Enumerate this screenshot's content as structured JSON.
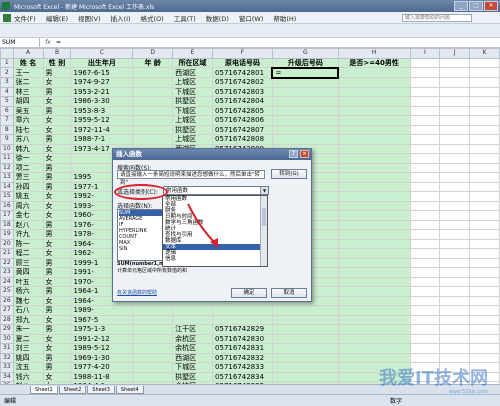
{
  "window": {
    "title": "Microsoft Excel - 新建 Microsoft Excel 工作表.xls"
  },
  "menu": [
    "文件(F)",
    "编辑(E)",
    "视图(V)",
    "插入(I)",
    "格式(O)",
    "工具(T)",
    "数据(D)",
    "窗口(W)",
    "帮助(H)"
  ],
  "help_placeholder": "键入需要帮助的问题",
  "formula": {
    "name_box": "SUM",
    "fx": "fx",
    "content": "="
  },
  "columns": [
    "A",
    "B",
    "C",
    "D",
    "E",
    "F",
    "G",
    "H",
    "I",
    "J",
    "K"
  ],
  "headers": [
    "姓 名",
    "性 别",
    "出生年月",
    "年 龄",
    "所在区域",
    "原电话号码",
    "升级后号码",
    "是否>=40男性"
  ],
  "rows": [
    [
      "王一",
      "男",
      "1967-6-15",
      "",
      "西湖区",
      "05716742801",
      "="
    ],
    [
      "张二",
      "女",
      "1974-9-27",
      "",
      "上城区",
      "05716742802",
      ""
    ],
    [
      "林三",
      "男",
      "1953-2-21",
      "",
      "下城区",
      "05716742803",
      ""
    ],
    [
      "胡四",
      "女",
      "1986-3-30",
      "",
      "拱墅区",
      "05716742804",
      ""
    ],
    [
      "吴五",
      "男",
      "1953-8-3",
      "",
      "下城区",
      "05716742805",
      ""
    ],
    [
      "章六",
      "女",
      "1959-5-12",
      "",
      "上城区",
      "05716742806",
      ""
    ],
    [
      "陆七",
      "女",
      "1972-11-4",
      "",
      "拱墅区",
      "05716742807",
      ""
    ],
    [
      "苏八",
      "男",
      "1988-7-1",
      "",
      "上城区",
      "05716742808",
      ""
    ],
    [
      "韩九",
      "女",
      "1973-4-17",
      "",
      "西湖区",
      "05716742809",
      ""
    ],
    [
      "徐一",
      "女",
      "",
      "",
      "",
      "",
      ""
    ],
    [
      "项二",
      "男",
      "",
      "",
      "",
      "",
      ""
    ],
    [
      "贾三",
      "男",
      "1995",
      "",
      "",
      "",
      ""
    ],
    [
      "孙四",
      "男",
      "1977-1",
      "",
      "",
      "",
      ""
    ],
    [
      "姚五",
      "女",
      "1992-",
      "",
      "",
      "",
      ""
    ],
    [
      "周六",
      "女",
      "1993-",
      "",
      "",
      "",
      ""
    ],
    [
      "金七",
      "女",
      "1960-",
      "",
      "",
      "",
      ""
    ],
    [
      "赵八",
      "男",
      "1976-",
      "",
      "",
      "",
      ""
    ],
    [
      "许九",
      "男",
      "1978-",
      "",
      "",
      "",
      ""
    ],
    [
      "陈一",
      "女",
      "1964-",
      "",
      "",
      "",
      ""
    ],
    [
      "程二",
      "女",
      "1962-",
      "",
      "",
      "",
      ""
    ],
    [
      "顾三",
      "男",
      "1999-1",
      "",
      "",
      "",
      ""
    ],
    [
      "黄四",
      "男",
      "1991-",
      "",
      "",
      "",
      ""
    ],
    [
      "叶五",
      "女",
      "1970-",
      "",
      "",
      "",
      ""
    ],
    [
      "杨六",
      "男",
      "1964-1",
      "",
      "",
      "",
      ""
    ],
    [
      "魏七",
      "女",
      "1964-",
      "",
      "",
      "",
      ""
    ],
    [
      "石八",
      "男",
      "1989-",
      "",
      "",
      "",
      ""
    ],
    [
      "郑九",
      "女",
      "1967-5",
      "",
      "",
      "",
      ""
    ],
    [
      "朱一",
      "男",
      "1975-1-3",
      "",
      "江干区",
      "05716742829",
      ""
    ],
    [
      "夏二",
      "女",
      "1991-2-12",
      "",
      "余杭区",
      "05716742830",
      ""
    ],
    [
      "刘三",
      "女",
      "1989-5-12",
      "",
      "余杭区",
      "05716742831",
      ""
    ],
    [
      "姚四",
      "男",
      "1969-1-30",
      "",
      "西湖区",
      "05716742832",
      ""
    ],
    [
      "沈五",
      "男",
      "1977-4-20",
      "",
      "下城区",
      "05716742833",
      ""
    ],
    [
      "钱六",
      "女",
      "1988-11-8",
      "",
      "拱墅区",
      "05716742834",
      ""
    ],
    [
      "刘八",
      "女",
      "1964-4-1",
      "",
      "余杭区",
      "05716742835",
      ""
    ]
  ],
  "sheets": [
    "Sheet1",
    "Sheet2",
    "Sheet3",
    "Sheet4"
  ],
  "status": {
    "mode": "编辑",
    "mode2": "数字"
  },
  "watermark": {
    "main": "我爱IT技术网",
    "sub": "www.52itjs.com"
  },
  "dialog": {
    "title": "插入函数",
    "help_btn": "?",
    "close_btn": "×",
    "search_label": "搜索函数(S):",
    "search_value": "请直接输入一条简短说明来描述您想做什么，然后单击\"转到\"",
    "go_btn": "转到(G)",
    "category_label": "或选择类别(C):",
    "category_value": "常用函数",
    "func_label": "选择函数(N):",
    "functions": [
      "SUM",
      "AVERAGE",
      "IF",
      "HYPERLINK",
      "COUNT",
      "MAX",
      "SIN"
    ],
    "signature": "SUM(number1,number2,...)",
    "description": "计算单元格区域中所有数值的和",
    "help_link": "有关该函数的帮助",
    "ok_btn": "确定",
    "cancel_btn": "取消",
    "dropdown_items": [
      "常用函数",
      "全部",
      "财务",
      "日期与时间",
      "数学与三角函数",
      "统计",
      "查找与引用",
      "数据库",
      "文本",
      "逻辑",
      "信息"
    ],
    "dropdown_selected_index": 8
  }
}
